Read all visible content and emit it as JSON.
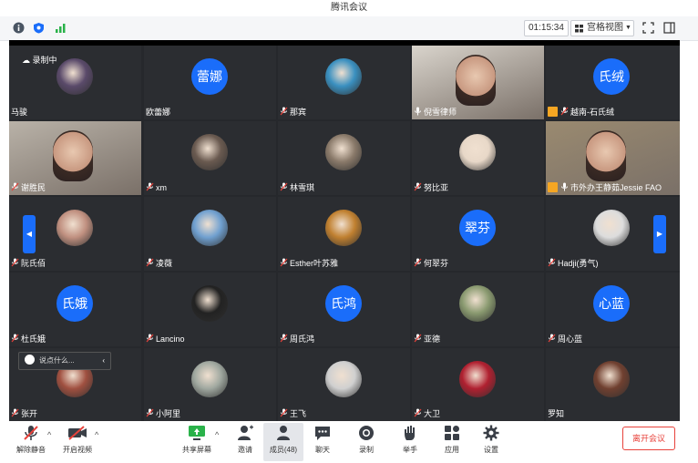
{
  "app": {
    "title": "腾讯会议"
  },
  "toolbar": {
    "timer": "01:15:34",
    "view_label": "宫格视图",
    "status_icons": [
      "info-icon",
      "shield-icon",
      "signal-icon"
    ]
  },
  "stage": {
    "recording_label": "录制中",
    "chat_placeholder": "说点什么...",
    "tiles": [
      {
        "name": "马骏",
        "type": "photo",
        "mic": false,
        "color": "#5a4a6a"
      },
      {
        "name": "欧蕾娜",
        "type": "text",
        "avatar_text": "蕾娜",
        "mic": false
      },
      {
        "name": "那宾",
        "type": "photo",
        "mic": true,
        "color": "#3a90c0"
      },
      {
        "name": "倪雪律师",
        "type": "video",
        "mic": true,
        "color": "#d9d4cc"
      },
      {
        "name": "越南-石氏绒",
        "type": "text",
        "avatar_text": "氏绒",
        "mic": true,
        "host": true
      },
      {
        "name": "谢胜民",
        "type": "video",
        "mic": true,
        "color": "#b9b2a8"
      },
      {
        "name": "xm",
        "type": "photo",
        "mic": true,
        "color": "#6a5a50"
      },
      {
        "name": "林雪琪",
        "type": "photo",
        "mic": true,
        "color": "#8a7a6a"
      },
      {
        "name": "努比亚",
        "type": "photo",
        "mic": true,
        "color": "#e8d8c8"
      },
      {
        "name": "市外办王静茹Jessie FAO",
        "type": "video",
        "mic": true,
        "host": true,
        "color": "#9a8a70"
      },
      {
        "name": "阮氏佰",
        "type": "photo",
        "mic": true,
        "color": "#c09080"
      },
      {
        "name": "凌薇",
        "type": "photo",
        "mic": true,
        "color": "#70a0d0"
      },
      {
        "name": "Esther叶苏雅",
        "type": "photo",
        "mic": true,
        "color": "#c08030"
      },
      {
        "name": "何翠芬",
        "type": "text",
        "avatar_text": "翠芬",
        "mic": true
      },
      {
        "name": "Hadji(勇气)",
        "type": "photo",
        "mic": true,
        "color": "#dddddd"
      },
      {
        "name": "杜氏娥",
        "type": "text",
        "avatar_text": "氏娥",
        "mic": true
      },
      {
        "name": "Lancino",
        "type": "photo",
        "mic": true,
        "color": "#222222"
      },
      {
        "name": "周氏鸿",
        "type": "text",
        "avatar_text": "氏鸿",
        "mic": true
      },
      {
        "name": "亚德",
        "type": "photo",
        "mic": true,
        "color": "#8a9a70"
      },
      {
        "name": "周心蓝",
        "type": "text",
        "avatar_text": "心蓝",
        "mic": true
      },
      {
        "name": "张开",
        "type": "photo",
        "mic": true,
        "color": "#a05040"
      },
      {
        "name": "小阿里",
        "type": "photo",
        "mic": true,
        "color": "#a0a8a0"
      },
      {
        "name": "王飞",
        "type": "photo",
        "mic": true,
        "color": "#d0d0d0"
      },
      {
        "name": "大卫",
        "type": "photo",
        "mic": true,
        "color": "#b02030"
      },
      {
        "name": "罗知",
        "type": "photo",
        "mic": false,
        "color": "#704030"
      }
    ]
  },
  "bottom": {
    "buttons": [
      {
        "id": "unmute",
        "label": "解除静音",
        "icon": "mic-muted-icon"
      },
      {
        "id": "video",
        "label": "开启视频",
        "icon": "camera-off-icon"
      },
      {
        "id": "share",
        "label": "共享屏幕",
        "icon": "share-screen-icon"
      },
      {
        "id": "invite",
        "label": "邀请",
        "icon": "add-user-icon"
      },
      {
        "id": "members",
        "label": "成员(48)",
        "icon": "members-icon"
      },
      {
        "id": "chat",
        "label": "聊天",
        "icon": "chat-icon"
      },
      {
        "id": "record",
        "label": "录制",
        "icon": "record-icon"
      },
      {
        "id": "raise",
        "label": "举手",
        "icon": "hand-icon"
      },
      {
        "id": "apps",
        "label": "应用",
        "icon": "apps-icon"
      },
      {
        "id": "settings",
        "label": "设置",
        "icon": "gear-icon"
      }
    ],
    "leave_label": "离开会议"
  }
}
